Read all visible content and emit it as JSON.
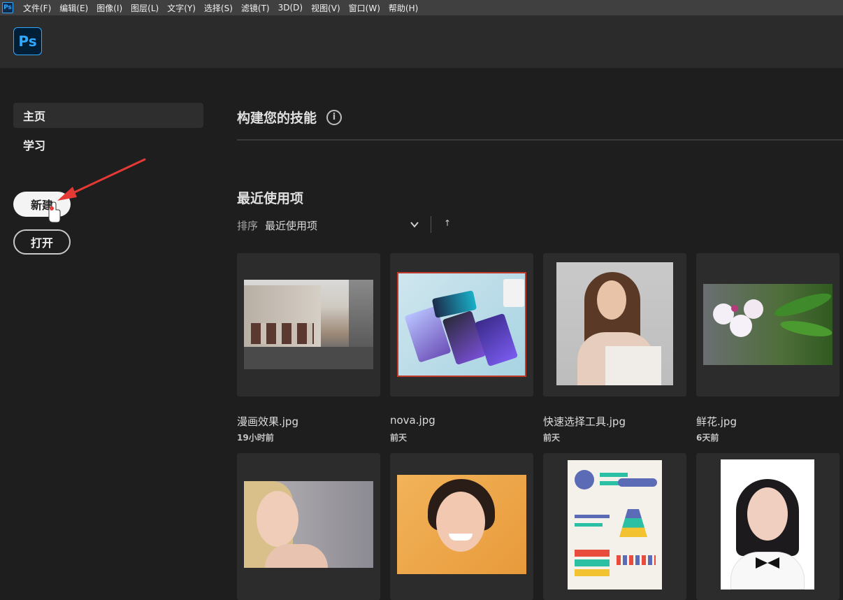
{
  "menubar": {
    "app_icon": "Ps",
    "items": [
      "文件(F)",
      "编辑(E)",
      "图像(I)",
      "图层(L)",
      "文字(Y)",
      "选择(S)",
      "滤镜(T)",
      "3D(D)",
      "视图(V)",
      "窗口(W)",
      "帮助(H)"
    ]
  },
  "header": {
    "logo": "Ps"
  },
  "sidebar": {
    "home": "主页",
    "learn": "学习",
    "new_button": "新建",
    "open_button": "打开"
  },
  "main": {
    "skills_title": "构建您的技能",
    "info_icon": "i",
    "recent_title": "最近使用项",
    "sort_label": "排序",
    "sort_value": "最近使用项",
    "sort_direction": "↑",
    "files": [
      {
        "name": "漫画效果.jpg",
        "time": "19小时前"
      },
      {
        "name": "nova.jpg",
        "time": "前天"
      },
      {
        "name": "快速选择工具.jpg",
        "time": "前天"
      },
      {
        "name": "鲜花.jpg",
        "time": "6天前"
      }
    ]
  },
  "colors": {
    "accent": "#31a8ff",
    "background": "#1e1e1e",
    "annotation_arrow": "#e53935"
  }
}
